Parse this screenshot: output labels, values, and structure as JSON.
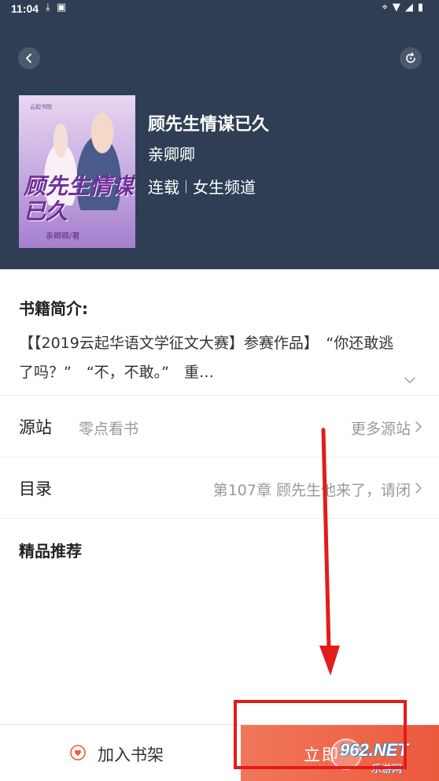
{
  "status_bar": {
    "time": "11:04",
    "left_icons": [
      "download-icon",
      "app-notification-icon"
    ],
    "right_icons": [
      "location-icon",
      "wifi-icon",
      "signal-icon",
      "battery-icon"
    ]
  },
  "header": {
    "back_icon": "chevron-left-icon",
    "refresh_icon": "refresh-icon",
    "background_color": "#2f3e55"
  },
  "book": {
    "cover": {
      "publisher": "云起书院",
      "title": "顾先生情谋已久",
      "author": "亲卿卿/著"
    },
    "title": "顾先生情谋已久",
    "author": "亲卿卿",
    "status": "连载",
    "channel": "女生频道"
  },
  "intro": {
    "heading": "书籍简介:",
    "text": "【【2019云起华语文学征文大赛】参赛作品】　“你还敢逃了吗？”　“不，不敢。”　重…"
  },
  "source": {
    "label": "源站",
    "value": "零点看书",
    "more": "更多源站"
  },
  "toc": {
    "label": "目录",
    "latest_chapter": "第107章 顾先生他来了，请闭"
  },
  "featured": {
    "heading": "精品推荐"
  },
  "bottom_bar": {
    "add_shelf_label": "加入书架",
    "read_now_label": "立即",
    "accent_color": "#ec5a3c"
  },
  "watermark": {
    "number": "962.NET",
    "caption": "乐游网"
  },
  "annotation": {
    "arrow_color": "#e31b1b",
    "box_color": "#e31b1b"
  }
}
